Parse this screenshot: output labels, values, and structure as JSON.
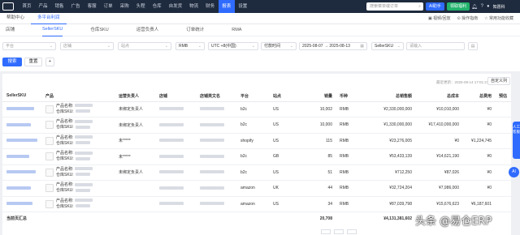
{
  "topnav": {
    "items": [
      "首页",
      "产品",
      "销售",
      "广告",
      "客服",
      "订单",
      "采购",
      "头程",
      "仓库",
      "自发货",
      "物流",
      "财务",
      "报表",
      "设置"
    ],
    "active_index": 12,
    "search_placeholder": "搜索菜单或订单",
    "ai_label": "AI助手",
    "green_label": "领取福利",
    "user_name": "知愿科"
  },
  "tabbar": {
    "tabs": [
      "帮助中心",
      "多平台利润"
    ],
    "active_index": 1,
    "right_links": [
      "▣ 视频/回放",
      "⊙ 操作指南",
      "☆ 常用功能收藏"
    ]
  },
  "subtabs": {
    "items": [
      "店铺",
      "SellerSKU",
      "仓库SKU",
      "运营负责人",
      "订单统计",
      "RMA"
    ],
    "active_index": 1
  },
  "filters": {
    "platform": "平台",
    "shop": "店铺",
    "site": "站点",
    "currency": "RMB",
    "timezone": "UTC +8(中国)",
    "time_type": "付款时间",
    "date_start": "2025-08-07",
    "date_sep": "→",
    "date_end": "2025-08-13",
    "sku_type": "SellerSKU",
    "keyword_placeholder": "请输入",
    "search_button": "搜索",
    "reset_button": "重置",
    "add_button": "+"
  },
  "toolbar": {
    "update_time": "最近更新：2025-08-14 17:01:27",
    "columns_button": "自定义列"
  },
  "table": {
    "headers": [
      "SellerSKU",
      "产品",
      "运营负责人",
      "店铺",
      "店铺英文名",
      "平台",
      "站点",
      "销量",
      "币种",
      "总销售额",
      "总成本",
      "总费用",
      "预估"
    ],
    "product_name_label": "产品名称:",
    "warehouse_sku_label": "仓库SKU:",
    "rows": [
      {
        "owner": "未绑定负责人",
        "platform": "b2c",
        "site": "US",
        "qty": "10,002",
        "currency": "RMB",
        "sales": "¥2,330,000,000",
        "cost": "¥10,010,000",
        "fee": "¥0",
        "est": ""
      },
      {
        "owner": "未绑定负责人",
        "platform": "b2c",
        "site": "US",
        "qty": "10,000",
        "currency": "RMB",
        "sales": "¥1,330,000,000",
        "cost": "¥17,410,000,000",
        "fee": "¥0",
        "est": ""
      },
      {
        "owner": "未*****",
        "platform": "shopify",
        "site": "US",
        "qty": "115",
        "currency": "RMB",
        "sales": "¥23,276,005",
        "cost": "¥0",
        "fee": "¥1,224,745",
        "est": ""
      },
      {
        "owner": "未*****",
        "platform": "b2c",
        "site": "GB",
        "qty": "85",
        "currency": "RMB",
        "sales": "¥53,433,139",
        "cost": "¥14,621,190",
        "fee": "¥0",
        "est": ""
      },
      {
        "owner": "未绑定负责人",
        "platform": "b2c",
        "site": "US",
        "qty": "51",
        "currency": "RMB",
        "sales": "¥712,250",
        "cost": "¥87,026",
        "fee": "¥0",
        "est": ""
      },
      {
        "owner": "",
        "platform": "amazon",
        "site": "UK",
        "qty": "44",
        "currency": "RMB",
        "sales": "¥32,724,204",
        "cost": "¥7,986,000",
        "fee": "¥0",
        "est": ""
      },
      {
        "owner": "",
        "platform": "amazon",
        "site": "US",
        "qty": "34",
        "currency": "RMB",
        "sales": "¥87,039,798",
        "cost": "¥15,676,623",
        "fee": "¥6,187,601",
        "est": ""
      }
    ],
    "total": {
      "label": "当前页汇总",
      "qty": "20,708",
      "sales": "¥4,131,381,602"
    }
  },
  "right_rail_label": "人工客服",
  "ai_float_label": "AI",
  "watermark": "头条 @易仓ERP",
  "colors": {
    "nav_bg": "#1e2a3d",
    "accent": "#2f6bff",
    "green": "#20b26b"
  }
}
